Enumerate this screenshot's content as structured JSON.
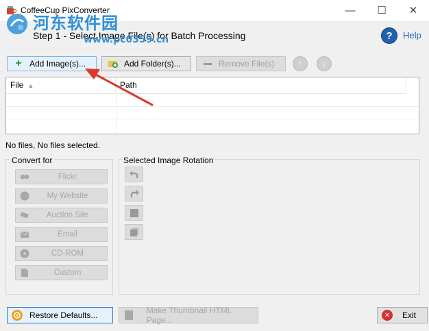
{
  "window": {
    "title": "CoffeeCup PixConverter",
    "minimize_glyph": "—",
    "maximize_glyph": "☐",
    "close_glyph": "✕"
  },
  "watermark": {
    "site_name": "河东软件园",
    "url": "www.pc0359.cn"
  },
  "header": {
    "step_title": "Step 1 - Select Image File(s) for Batch Processing",
    "help_label": "Help",
    "help_glyph": "?"
  },
  "toolbar": {
    "add_images_label": "Add Image(s)...",
    "add_folder_label": "Add Folder(s)...",
    "remove_files_label": "Remove File(s)",
    "move_up_glyph": "↑",
    "move_down_glyph": "↓"
  },
  "file_table": {
    "columns": [
      "File",
      "Path"
    ],
    "sort_glyph": "▲",
    "rows": []
  },
  "status_text": "No files, No files selected.",
  "convert_for": {
    "title": "Convert for",
    "buttons": [
      "Flickr",
      "My Website",
      "Auction Site",
      "Email",
      "CD-ROM",
      "Custom"
    ]
  },
  "rotation": {
    "title": "Selected Image Rotation"
  },
  "footer": {
    "restore_label": "Restore Defaults...",
    "thumbnail_label": "Make Thumbnail HTML Page...",
    "exit_label": "Exit"
  },
  "colors": {
    "accent": "#2b7cd6",
    "help": "#1e62b0",
    "annotation_arrow": "#d83a2c",
    "watermark": "#2f8fd8"
  }
}
